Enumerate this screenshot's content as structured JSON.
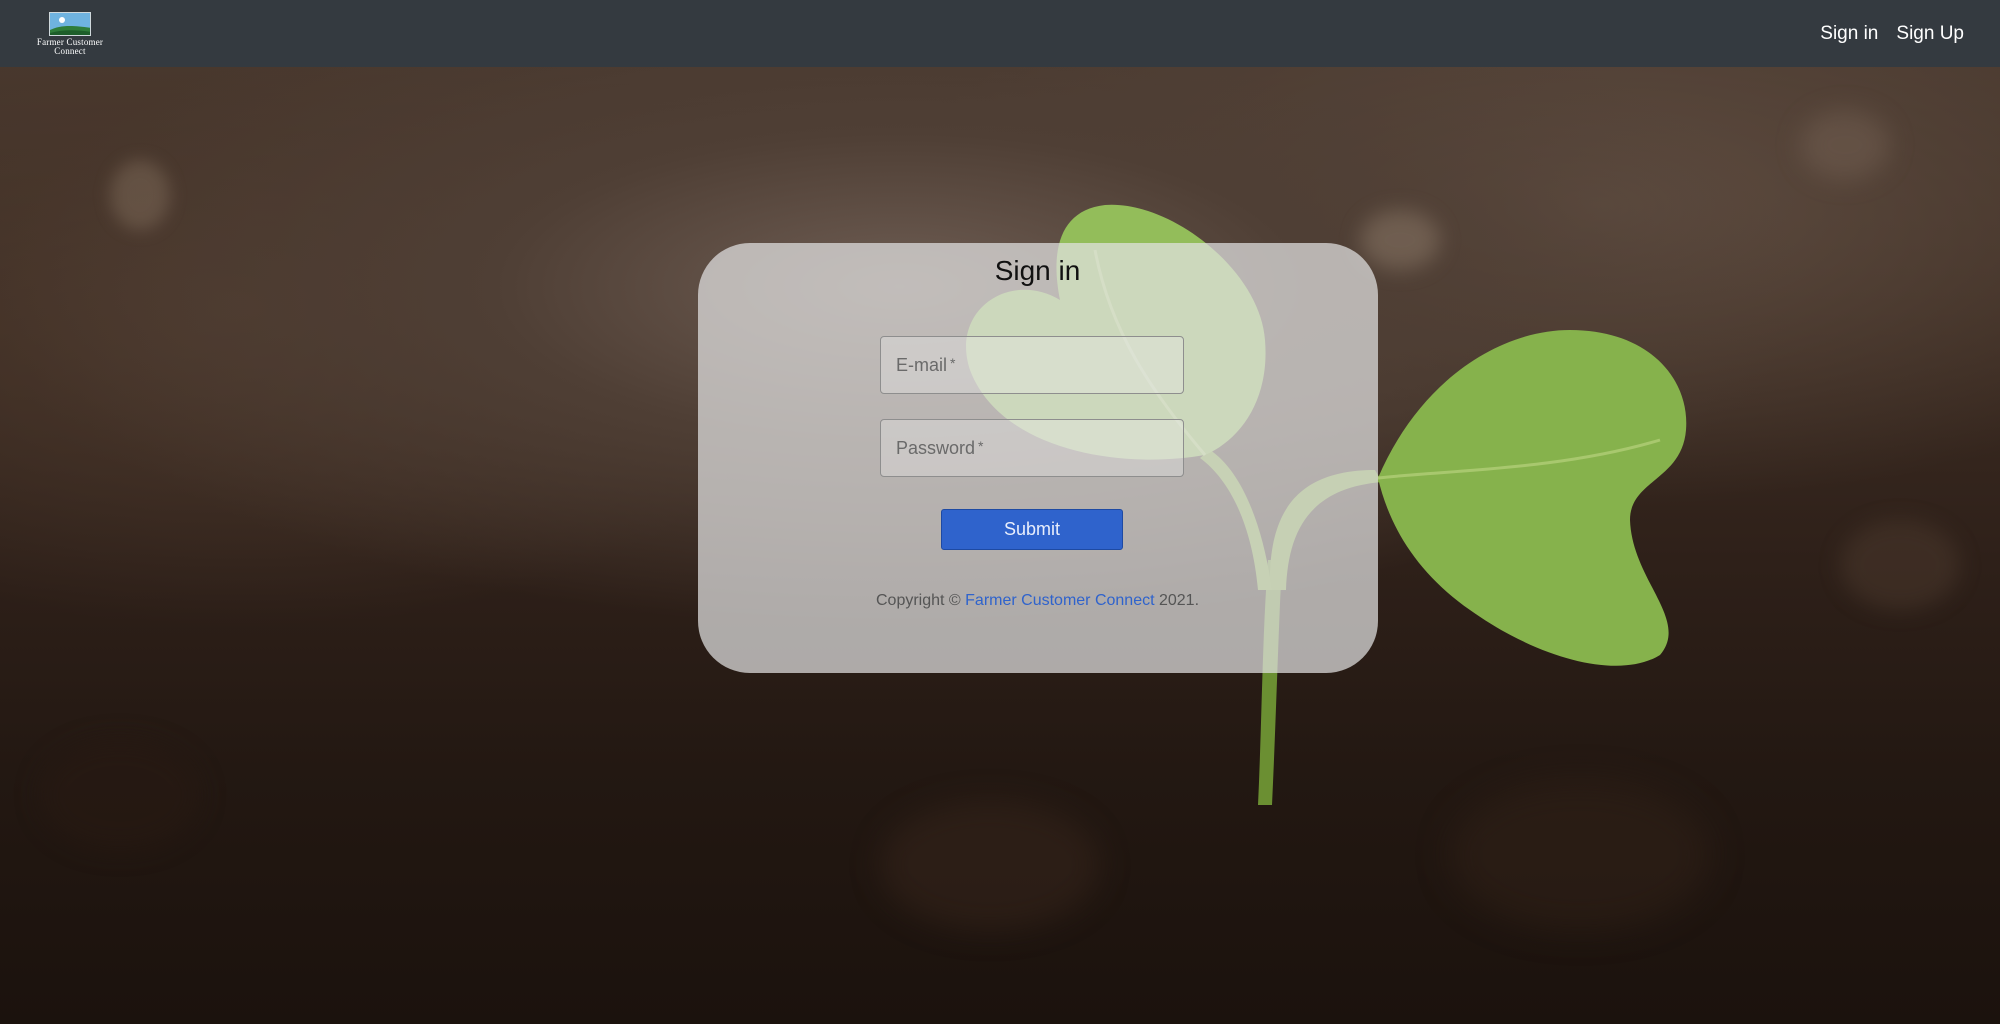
{
  "navbar": {
    "brand_line1": "Farmer Customer",
    "brand_line2": "Connect",
    "links": [
      "Sign in",
      "Sign Up"
    ]
  },
  "form": {
    "title": "Sign in",
    "email_label": "E-mail",
    "password_label": "Password",
    "required_mark": "*",
    "submit_label": "Submit"
  },
  "footer": {
    "prefix": "Copyright © ",
    "link_text": "Farmer Customer Connect",
    "suffix": " 2021."
  },
  "colors": {
    "navbar": "#343a40",
    "accent": "#2f63cc"
  }
}
